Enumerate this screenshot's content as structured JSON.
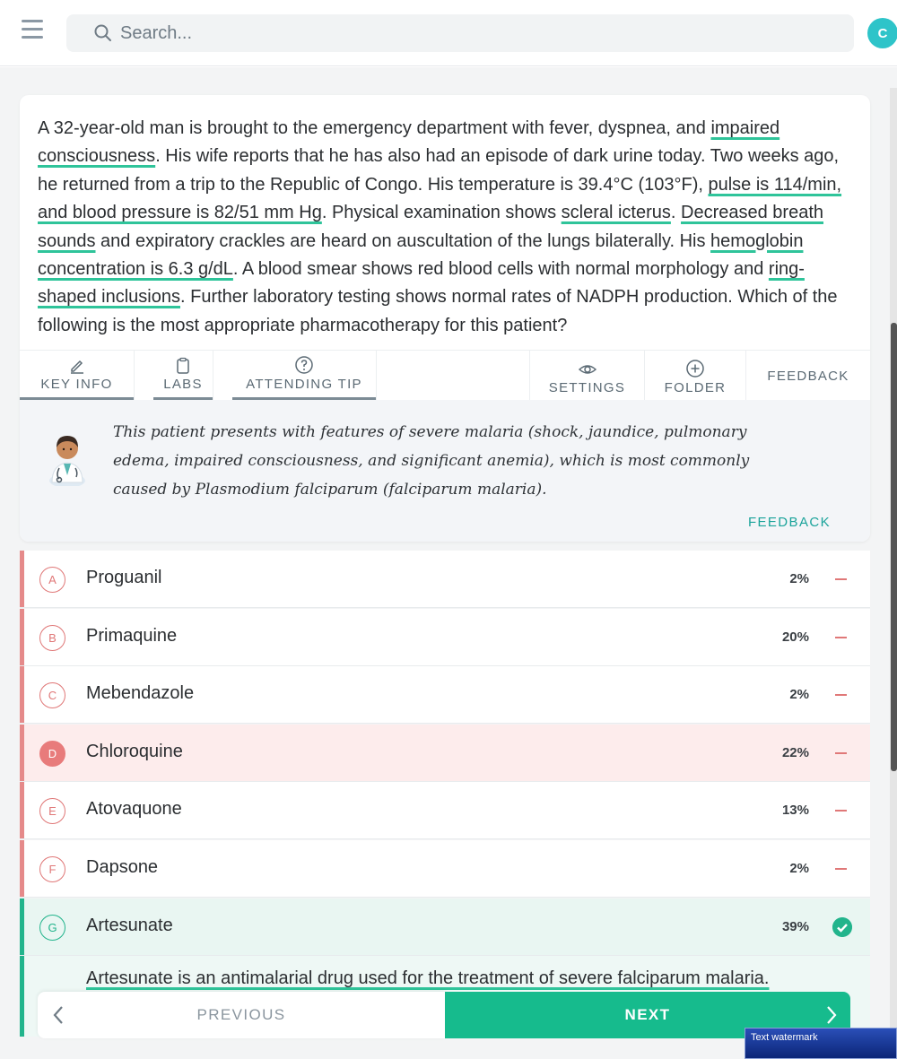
{
  "header": {
    "search_placeholder": "Search...",
    "avatar_initial": "C"
  },
  "question": {
    "stem_parts": [
      {
        "text": "A 32-year-old man is brought to the emergency department with fever, dyspnea, and ",
        "hl": false
      },
      {
        "text": "impaired consciousness",
        "hl": true
      },
      {
        "text": ". His wife reports that he has also had an episode of dark urine today. Two weeks ago, he returned from a trip to the Republic of Congo. His temperature is 39.4°C (103°F), ",
        "hl": false
      },
      {
        "text": "pulse is 114/min, and blood pressure is 82/51 mm Hg",
        "hl": true
      },
      {
        "text": ". Physical examination shows ",
        "hl": false
      },
      {
        "text": "scleral icterus",
        "hl": true
      },
      {
        "text": ". ",
        "hl": false
      },
      {
        "text": "Decreased breath sounds",
        "hl": true
      },
      {
        "text": " and expiratory crackles are heard on auscultation of the lungs bilaterally. His ",
        "hl": false
      },
      {
        "text": "hemoglobin concentration is 6.3 g/dL",
        "hl": true
      },
      {
        "text": ". A blood smear shows red blood cells with normal morphology and ",
        "hl": false
      },
      {
        "text": "ring-shaped inclusions",
        "hl": true
      },
      {
        "text": ". Further laboratory testing shows normal rates of NADPH production. Which of the following is the most appropriate pharmacotherapy for this patient?",
        "hl": false
      }
    ]
  },
  "tabs": {
    "key_info": "KEY INFO",
    "labs": "LABS",
    "attending_tip": "ATTENDING TIP",
    "settings": "SETTINGS",
    "folder": "FOLDER",
    "feedback": "FEEDBACK"
  },
  "tip": {
    "text": "This patient presents with features of severe malaria (shock, jaundice, pulmonary edema, impaired consciousness, and significant anemia), which is most commonly caused by Plasmodium falciparum (falciparum malaria).",
    "feedback": "FEEDBACK"
  },
  "answers": [
    {
      "letter": "A",
      "text": "Proguanil",
      "pct": "2%",
      "state": "wrong"
    },
    {
      "letter": "B",
      "text": "Primaquine",
      "pct": "20%",
      "state": "wrong"
    },
    {
      "letter": "C",
      "text": "Mebendazole",
      "pct": "2%",
      "state": "wrong"
    },
    {
      "letter": "D",
      "text": "Chloroquine",
      "pct": "22%",
      "state": "selected"
    },
    {
      "letter": "E",
      "text": "Atovaquone",
      "pct": "13%",
      "state": "wrong"
    },
    {
      "letter": "F",
      "text": "Dapsone",
      "pct": "2%",
      "state": "wrong"
    },
    {
      "letter": "G",
      "text": "Artesunate",
      "pct": "39%",
      "state": "correct"
    }
  ],
  "explanation": {
    "text": "Artesunate is an antimalarial drug used for the treatment of severe falciparum malaria."
  },
  "nav": {
    "previous": "PREVIOUS",
    "next": "NEXT"
  },
  "watermark": "Text watermark",
  "colors": {
    "accent_green": "#16bb8d",
    "highlight_underline": "#2fc49a",
    "wrong_red": "#e07878",
    "avatar": "#2ec4c9"
  }
}
